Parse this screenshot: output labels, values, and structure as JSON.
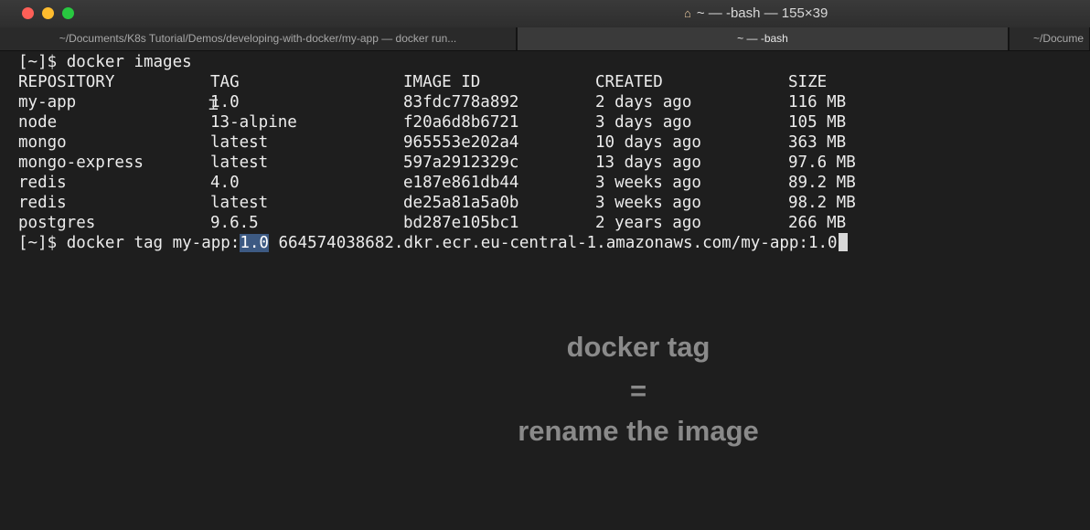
{
  "window": {
    "title": "~ — -bash — 155×39",
    "icon": "home-icon"
  },
  "tabs": [
    {
      "label": "~/Documents/K8s Tutorial/Demos/developing-with-docker/my-app — docker run...",
      "active": false
    },
    {
      "label": "~ — -bash",
      "active": true
    },
    {
      "label": "~/Docume",
      "active": false
    }
  ],
  "terminal": {
    "prompt": "[~]$ ",
    "command1": "docker images",
    "headers": [
      "REPOSITORY",
      "TAG",
      "IMAGE ID",
      "CREATED",
      "SIZE"
    ],
    "rows": [
      [
        "my-app",
        "1.0",
        "83fdc778a892",
        "2 days ago",
        "116 MB"
      ],
      [
        "node",
        "13-alpine",
        "f20a6d8b6721",
        "3 days ago",
        "105 MB"
      ],
      [
        "mongo",
        "latest",
        "965553e202a4",
        "10 days ago",
        "363 MB"
      ],
      [
        "mongo-express",
        "latest",
        "597a2912329c",
        "13 days ago",
        "97.6 MB"
      ],
      [
        "redis",
        "4.0",
        "e187e861db44",
        "3 weeks ago",
        "89.2 MB"
      ],
      [
        "redis",
        "latest",
        "de25a81a5a0b",
        "3 weeks ago",
        "98.2 MB"
      ],
      [
        "postgres",
        "9.6.5",
        "bd287e105bc1",
        "2 years ago",
        "266 MB"
      ]
    ],
    "command2_before": "docker tag my-app:",
    "command2_selected": "1.0",
    "command2_after": " 664574038682.dkr.ecr.eu-central-1.amazonaws.com/my-app:1.0"
  },
  "caption": {
    "line1": "docker tag",
    "line2": "=",
    "line3": "rename the image"
  },
  "colors": {
    "background": "#1e1e1e",
    "text": "#ececec",
    "selection": "#3d5a83",
    "caption": "#8a8a8a"
  }
}
